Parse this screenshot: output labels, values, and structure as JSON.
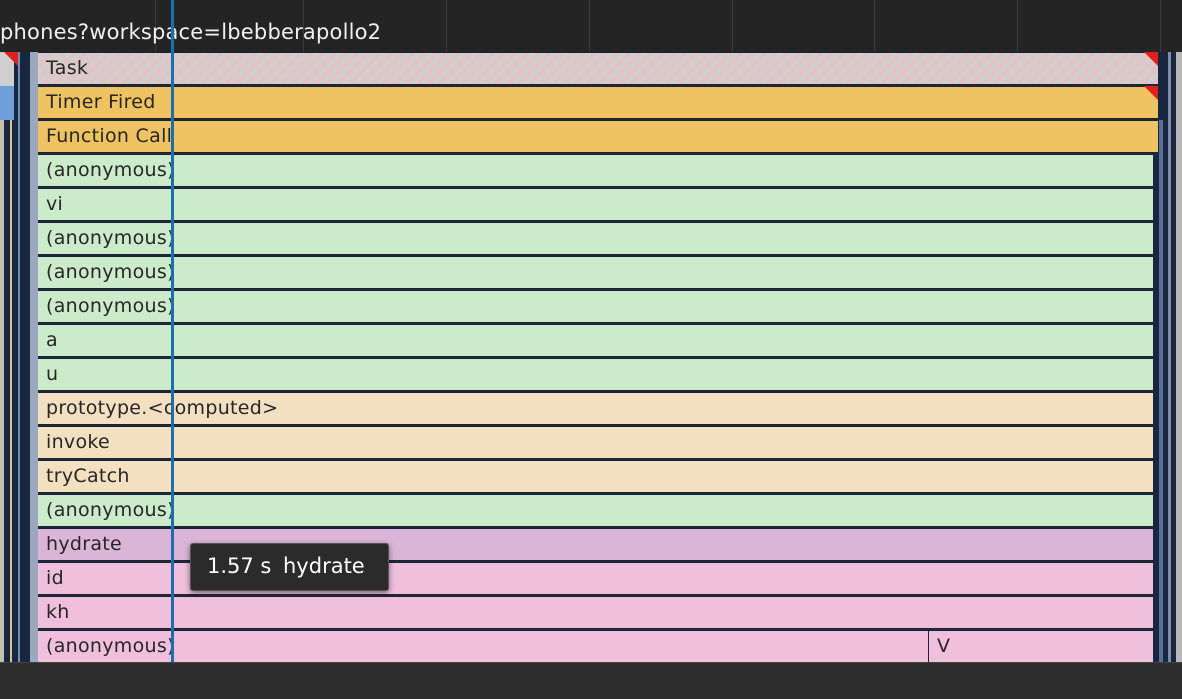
{
  "header": {
    "url_text": "phones?workspace=lbebberapollo2"
  },
  "flame_rows": [
    {
      "label": "Task",
      "category": "task"
    },
    {
      "label": "Timer Fired",
      "category": "script-event"
    },
    {
      "label": "Function Call",
      "category": "script-event"
    },
    {
      "label": "(anonymous)",
      "category": "js-frame"
    },
    {
      "label": "vi",
      "category": "js-frame"
    },
    {
      "label": "(anonymous)",
      "category": "js-frame"
    },
    {
      "label": "(anonymous)",
      "category": "js-frame"
    },
    {
      "label": "(anonymous)",
      "category": "js-frame"
    },
    {
      "label": "a",
      "category": "js-frame"
    },
    {
      "label": "u",
      "category": "js-frame"
    },
    {
      "label": "prototype.<computed>",
      "category": "runtime-frame"
    },
    {
      "label": "invoke",
      "category": "runtime-frame"
    },
    {
      "label": "tryCatch",
      "category": "runtime-frame"
    },
    {
      "label": "(anonymous)",
      "category": "js-frame"
    },
    {
      "label": "hydrate",
      "category": "app-frame-selected"
    },
    {
      "label": "id",
      "category": "app-frame"
    },
    {
      "label": "kh",
      "category": "app-frame"
    },
    {
      "label": "(anonymous)",
      "category": "app-frame"
    }
  ],
  "extra_frame": {
    "label": "V"
  },
  "tooltip": {
    "duration": "1.57 s",
    "name": "hydrate"
  },
  "colors": {
    "script_event": "#efc262",
    "js_frame": "#cbebca",
    "runtime_frame": "#f2e0c0",
    "app_frame": "#f0bfdc",
    "selected": "#dbb5d7",
    "cursor": "#1a6fb0"
  }
}
